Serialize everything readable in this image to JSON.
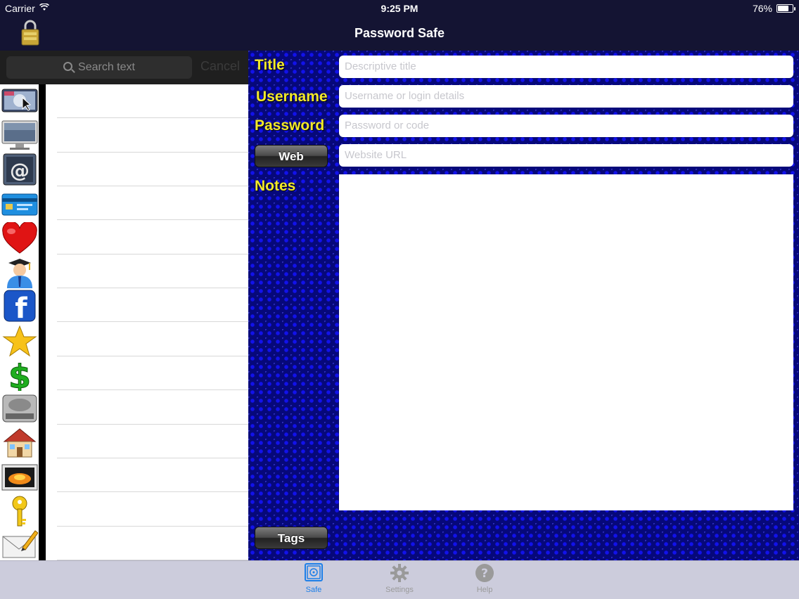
{
  "status_bar": {
    "carrier": "Carrier",
    "time": "9:25 PM",
    "battery": "76%",
    "battery_level": 0.76
  },
  "nav": {
    "title": "Password Safe",
    "left_icon": "padlock-icon"
  },
  "search": {
    "placeholder": "Search text",
    "cancel_label": "Cancel"
  },
  "categories": [
    {
      "name": "computer-screen-icon"
    },
    {
      "name": "monitor-icon"
    },
    {
      "name": "email-at-icon"
    },
    {
      "name": "credit-card-icon"
    },
    {
      "name": "heart-icon"
    },
    {
      "name": "graduate-icon"
    },
    {
      "name": "facebook-icon"
    },
    {
      "name": "star-icon"
    },
    {
      "name": "dollar-icon"
    },
    {
      "name": "hard-drive-icon"
    },
    {
      "name": "house-icon"
    },
    {
      "name": "picture-icon"
    },
    {
      "name": "key-icon"
    },
    {
      "name": "envelope-pencil-icon"
    }
  ],
  "list": {
    "row_count": 14
  },
  "form": {
    "title_label": "Title",
    "title_placeholder": "Descriptive title",
    "username_label": "Username",
    "username_placeholder": "Username or login details",
    "password_label": "Password",
    "password_placeholder": "Password or code",
    "web_button": "Web",
    "website_placeholder": "Website URL",
    "notes_label": "Notes",
    "tags_button": "Tags"
  },
  "tabbar": {
    "tabs": [
      {
        "label": "Safe",
        "icon": "safe-icon",
        "active": true
      },
      {
        "label": "Settings",
        "icon": "gear-icon",
        "active": false
      },
      {
        "label": "Help",
        "icon": "help-icon",
        "active": false
      }
    ]
  },
  "colors": {
    "label_yellow": "#f2e92a",
    "nav_bg": "#141433",
    "tab_active": "#1d7fe8",
    "pattern_blue": "#06087a"
  }
}
